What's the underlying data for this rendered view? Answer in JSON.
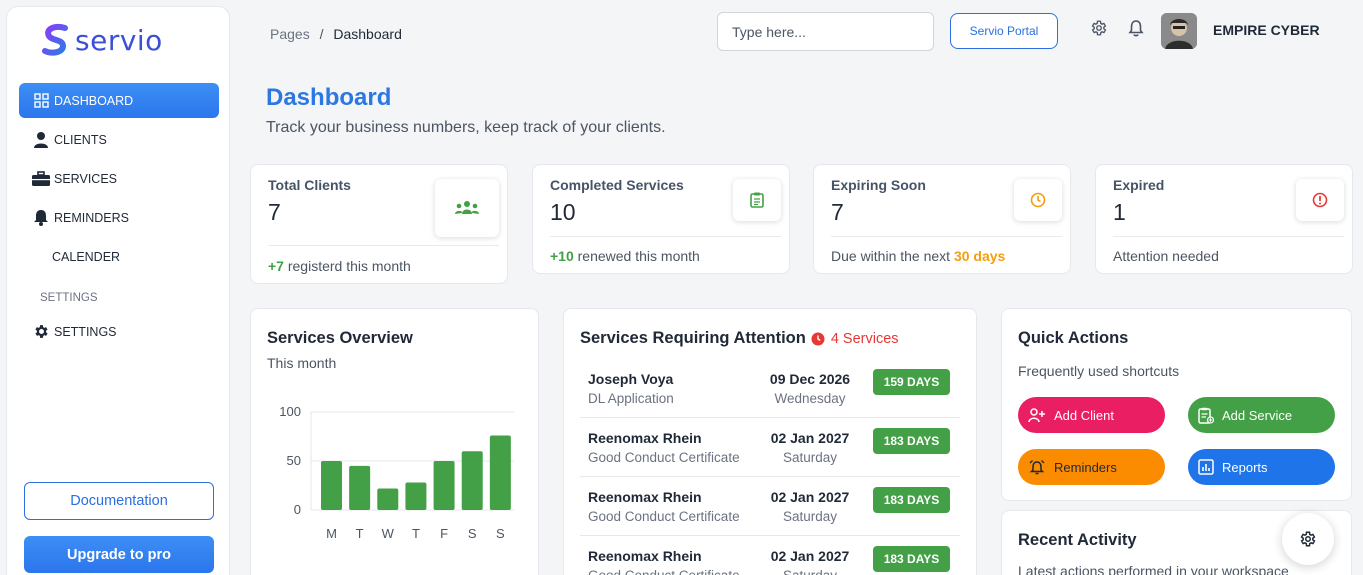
{
  "brand": {
    "name": "servio"
  },
  "sidebar": {
    "items": [
      {
        "label": "DASHBOARD",
        "icon": "dashboard-grid-icon",
        "active": true
      },
      {
        "label": "CLIENTS",
        "icon": "user-icon"
      },
      {
        "label": "SERVICES",
        "icon": "briefcase-icon"
      },
      {
        "label": "REMINDERS",
        "icon": "bell-icon"
      },
      {
        "label": "CALENDER",
        "icon": "none"
      }
    ],
    "section_label": "SETTINGS",
    "settings_item": {
      "label": "SETTINGS",
      "icon": "gear-icon"
    },
    "documentation_label": "Documentation",
    "upgrade_label": "Upgrade to pro"
  },
  "header": {
    "breadcrumb": {
      "parent": "Pages",
      "separator": "/",
      "current": "Dashboard"
    },
    "search_placeholder": "Type here...",
    "portal_label": "Servio Portal",
    "username": "EMPIRE CYBER"
  },
  "page": {
    "title": "Dashboard",
    "subtitle": "Track your business numbers, keep track of your clients."
  },
  "stats": [
    {
      "label": "Total Clients",
      "value": "7",
      "foot_highlight": "+7",
      "foot_text": " registerd this month",
      "icon": "users-icon",
      "accent": "#43a047"
    },
    {
      "label": "Completed Services",
      "value": "10",
      "foot_highlight": "+10",
      "foot_text": " renewed this month",
      "icon": "clipboard-check-icon",
      "accent": "#43a047"
    },
    {
      "label": "Expiring Soon",
      "value": "7",
      "foot_prefix": "Due within the next ",
      "foot_highlight": "30 days",
      "icon": "clock-icon",
      "accent": "#f59e0b"
    },
    {
      "label": "Expired",
      "value": "1",
      "foot_text": "Attention needed",
      "icon": "alert-circle-icon",
      "accent": "#e53935"
    }
  ],
  "overview": {
    "title": "Services Overview",
    "subtitle": "This month"
  },
  "chart_data": {
    "type": "bar",
    "categories": [
      "M",
      "T",
      "W",
      "T",
      "F",
      "S",
      "S"
    ],
    "values": [
      50,
      45,
      22,
      28,
      50,
      60,
      76
    ],
    "ylim": [
      0,
      100
    ],
    "yticks": [
      "100",
      "50",
      "0"
    ],
    "color": "#43a047",
    "grid": true
  },
  "attention": {
    "title": "Services Requiring Attention",
    "count_label": "4 Services",
    "rows": [
      {
        "name": "Joseph Voya",
        "type": "DL Application",
        "date": "09 Dec 2026",
        "day": "Wednesday",
        "badge": "159 DAYS"
      },
      {
        "name": "Reenomax Rhein",
        "type": "Good Conduct Certificate",
        "date": "02 Jan 2027",
        "day": "Saturday",
        "badge": "183 DAYS"
      },
      {
        "name": "Reenomax Rhein",
        "type": "Good Conduct Certificate",
        "date": "02 Jan 2027",
        "day": "Saturday",
        "badge": "183 DAYS"
      },
      {
        "name": "Reenomax Rhein",
        "type": "Good Conduct Certificate",
        "date": "02 Jan 2027",
        "day": "Saturday",
        "badge": "183 DAYS"
      }
    ]
  },
  "quick_actions": {
    "title": "Quick Actions",
    "subtitle": "Frequently used shortcuts",
    "buttons": [
      {
        "label": "Add Client",
        "color": "#e91e63",
        "icon": "user-plus-icon"
      },
      {
        "label": "Add Service",
        "color": "#43a047",
        "icon": "clipboard-plus-icon"
      },
      {
        "label": "Reminders",
        "color": "#fb8c00",
        "icon": "alarm-icon"
      },
      {
        "label": "Reports",
        "color": "#1e74e8",
        "icon": "chart-icon"
      }
    ]
  },
  "recent": {
    "title": "Recent Activity",
    "subtitle": "Latest actions performed in your workspace"
  }
}
